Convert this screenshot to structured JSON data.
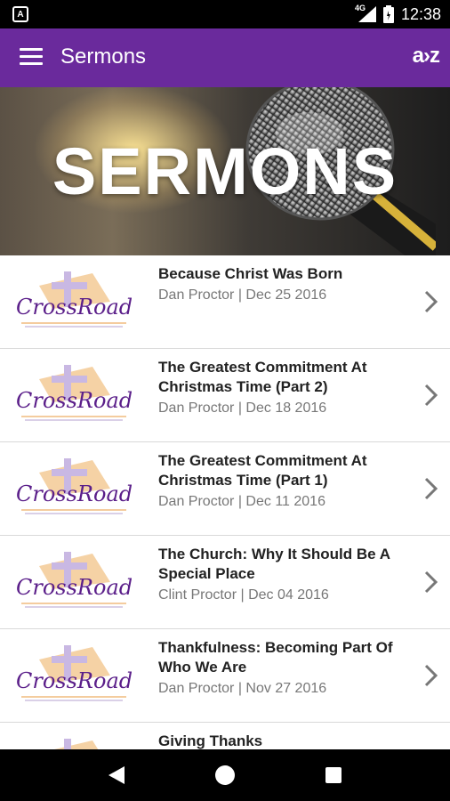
{
  "status_bar": {
    "left_icon": "A",
    "network": "4G",
    "time": "12:38"
  },
  "app_bar": {
    "title": "Sermons",
    "sort_icon": "A>Z",
    "sort_label": "a›z"
  },
  "banner": {
    "title": "SERMONS"
  },
  "thumbnail": {
    "logo_text": "CrossRoads"
  },
  "sermons": [
    {
      "title": "Because Christ Was Born",
      "subtitle": "Dan Proctor | Dec 25 2016"
    },
    {
      "title": "The Greatest Commitment At Christmas Time (Part 2)",
      "subtitle": "Dan Proctor | Dec 18 2016"
    },
    {
      "title": "The Greatest Commitment At Christmas Time (Part 1)",
      "subtitle": "Dan Proctor | Dec 11 2016"
    },
    {
      "title": "The Church: Why It Should Be A Special Place",
      "subtitle": "Clint Proctor | Dec 04 2016"
    },
    {
      "title": "Thankfulness: Becoming Part Of Who We Are",
      "subtitle": "Dan Proctor | Nov 27 2016"
    },
    {
      "title": "Giving Thanks",
      "subtitle": ""
    }
  ],
  "colors": {
    "app_bar": "#6a2a9c",
    "logo_purple": "#5b1f8a",
    "logo_orange": "#e89a3c"
  }
}
